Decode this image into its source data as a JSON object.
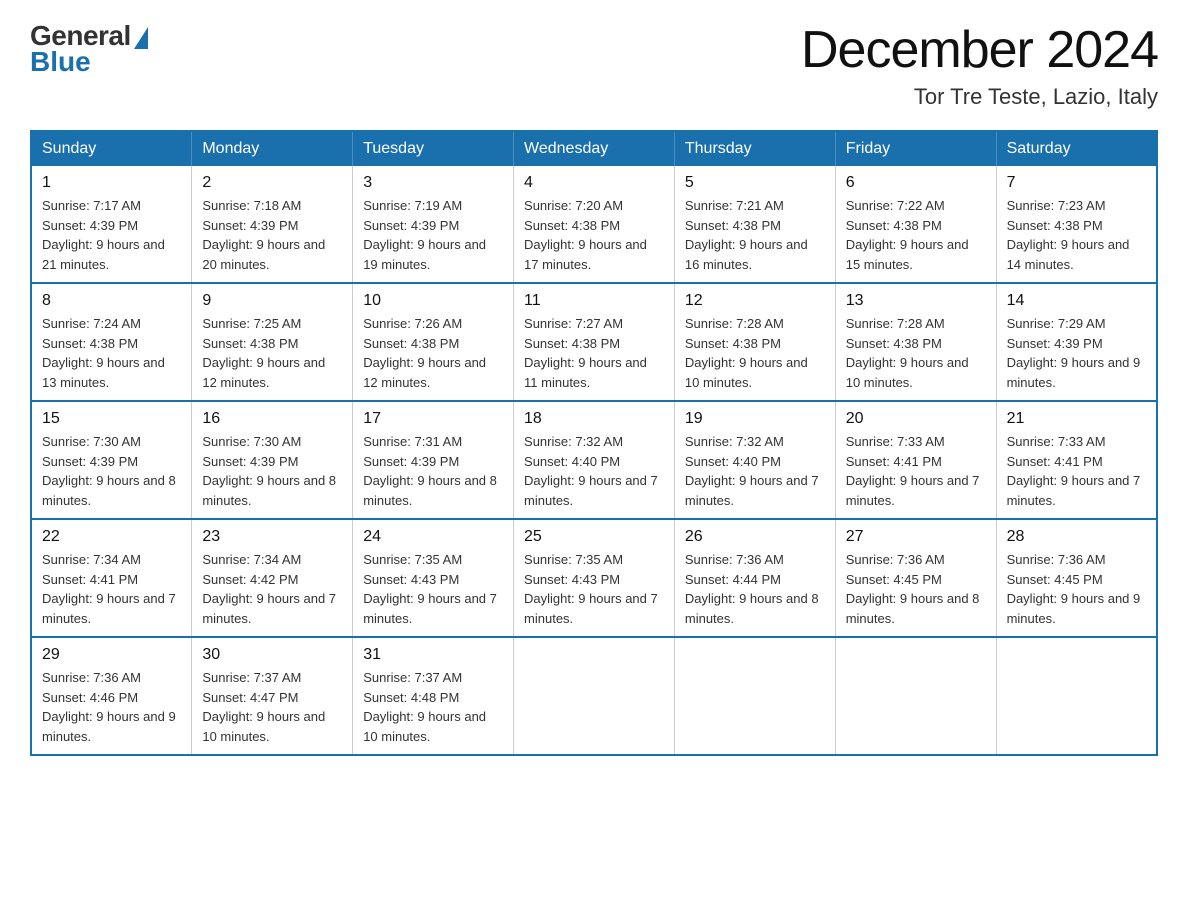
{
  "logo": {
    "general": "General",
    "blue": "Blue"
  },
  "header": {
    "month_year": "December 2024",
    "location": "Tor Tre Teste, Lazio, Italy"
  },
  "weekdays": [
    "Sunday",
    "Monday",
    "Tuesday",
    "Wednesday",
    "Thursday",
    "Friday",
    "Saturday"
  ],
  "weeks": [
    [
      {
        "day": "1",
        "sunrise": "7:17 AM",
        "sunset": "4:39 PM",
        "daylight": "9 hours and 21 minutes."
      },
      {
        "day": "2",
        "sunrise": "7:18 AM",
        "sunset": "4:39 PM",
        "daylight": "9 hours and 20 minutes."
      },
      {
        "day": "3",
        "sunrise": "7:19 AM",
        "sunset": "4:39 PM",
        "daylight": "9 hours and 19 minutes."
      },
      {
        "day": "4",
        "sunrise": "7:20 AM",
        "sunset": "4:38 PM",
        "daylight": "9 hours and 17 minutes."
      },
      {
        "day": "5",
        "sunrise": "7:21 AM",
        "sunset": "4:38 PM",
        "daylight": "9 hours and 16 minutes."
      },
      {
        "day": "6",
        "sunrise": "7:22 AM",
        "sunset": "4:38 PM",
        "daylight": "9 hours and 15 minutes."
      },
      {
        "day": "7",
        "sunrise": "7:23 AM",
        "sunset": "4:38 PM",
        "daylight": "9 hours and 14 minutes."
      }
    ],
    [
      {
        "day": "8",
        "sunrise": "7:24 AM",
        "sunset": "4:38 PM",
        "daylight": "9 hours and 13 minutes."
      },
      {
        "day": "9",
        "sunrise": "7:25 AM",
        "sunset": "4:38 PM",
        "daylight": "9 hours and 12 minutes."
      },
      {
        "day": "10",
        "sunrise": "7:26 AM",
        "sunset": "4:38 PM",
        "daylight": "9 hours and 12 minutes."
      },
      {
        "day": "11",
        "sunrise": "7:27 AM",
        "sunset": "4:38 PM",
        "daylight": "9 hours and 11 minutes."
      },
      {
        "day": "12",
        "sunrise": "7:28 AM",
        "sunset": "4:38 PM",
        "daylight": "9 hours and 10 minutes."
      },
      {
        "day": "13",
        "sunrise": "7:28 AM",
        "sunset": "4:38 PM",
        "daylight": "9 hours and 10 minutes."
      },
      {
        "day": "14",
        "sunrise": "7:29 AM",
        "sunset": "4:39 PM",
        "daylight": "9 hours and 9 minutes."
      }
    ],
    [
      {
        "day": "15",
        "sunrise": "7:30 AM",
        "sunset": "4:39 PM",
        "daylight": "9 hours and 8 minutes."
      },
      {
        "day": "16",
        "sunrise": "7:30 AM",
        "sunset": "4:39 PM",
        "daylight": "9 hours and 8 minutes."
      },
      {
        "day": "17",
        "sunrise": "7:31 AM",
        "sunset": "4:39 PM",
        "daylight": "9 hours and 8 minutes."
      },
      {
        "day": "18",
        "sunrise": "7:32 AM",
        "sunset": "4:40 PM",
        "daylight": "9 hours and 7 minutes."
      },
      {
        "day": "19",
        "sunrise": "7:32 AM",
        "sunset": "4:40 PM",
        "daylight": "9 hours and 7 minutes."
      },
      {
        "day": "20",
        "sunrise": "7:33 AM",
        "sunset": "4:41 PM",
        "daylight": "9 hours and 7 minutes."
      },
      {
        "day": "21",
        "sunrise": "7:33 AM",
        "sunset": "4:41 PM",
        "daylight": "9 hours and 7 minutes."
      }
    ],
    [
      {
        "day": "22",
        "sunrise": "7:34 AM",
        "sunset": "4:41 PM",
        "daylight": "9 hours and 7 minutes."
      },
      {
        "day": "23",
        "sunrise": "7:34 AM",
        "sunset": "4:42 PM",
        "daylight": "9 hours and 7 minutes."
      },
      {
        "day": "24",
        "sunrise": "7:35 AM",
        "sunset": "4:43 PM",
        "daylight": "9 hours and 7 minutes."
      },
      {
        "day": "25",
        "sunrise": "7:35 AM",
        "sunset": "4:43 PM",
        "daylight": "9 hours and 7 minutes."
      },
      {
        "day": "26",
        "sunrise": "7:36 AM",
        "sunset": "4:44 PM",
        "daylight": "9 hours and 8 minutes."
      },
      {
        "day": "27",
        "sunrise": "7:36 AM",
        "sunset": "4:45 PM",
        "daylight": "9 hours and 8 minutes."
      },
      {
        "day": "28",
        "sunrise": "7:36 AM",
        "sunset": "4:45 PM",
        "daylight": "9 hours and 9 minutes."
      }
    ],
    [
      {
        "day": "29",
        "sunrise": "7:36 AM",
        "sunset": "4:46 PM",
        "daylight": "9 hours and 9 minutes."
      },
      {
        "day": "30",
        "sunrise": "7:37 AM",
        "sunset": "4:47 PM",
        "daylight": "9 hours and 10 minutes."
      },
      {
        "day": "31",
        "sunrise": "7:37 AM",
        "sunset": "4:48 PM",
        "daylight": "9 hours and 10 minutes."
      },
      null,
      null,
      null,
      null
    ]
  ],
  "labels": {
    "sunrise": "Sunrise:",
    "sunset": "Sunset:",
    "daylight": "Daylight:"
  }
}
